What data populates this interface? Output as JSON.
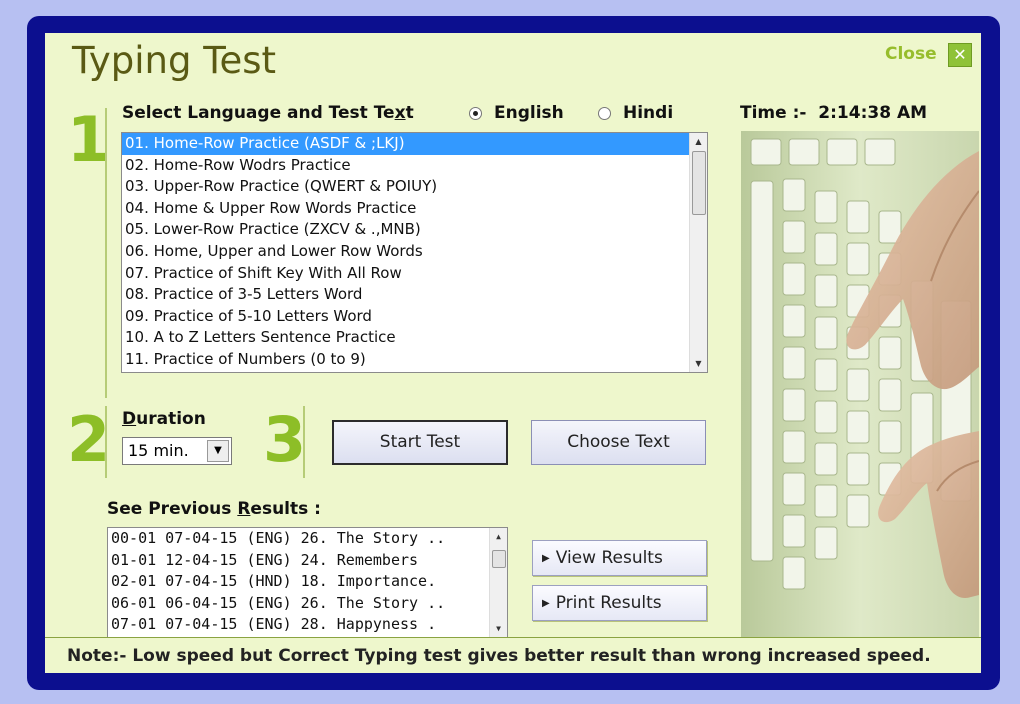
{
  "window": {
    "title": "Typing Test",
    "close_label": "Close",
    "close_icon": "x-icon"
  },
  "step_numbers": [
    "1",
    "2",
    "3"
  ],
  "language_section": {
    "label_pre": "Select Language and Test Te",
    "label_ul": "x",
    "label_post": "t",
    "languages": [
      "English",
      "Hindi"
    ],
    "selected_language": "English"
  },
  "time": {
    "label": "Time :-",
    "value": "2:14:38 AM"
  },
  "test_list": {
    "items": [
      "01. Home-Row Practice (ASDF & ;LKJ)",
      "02. Home-Row Wodrs Practice",
      "03. Upper-Row Practice (QWERT & POIUY)",
      "04. Home & Upper Row Words Practice",
      "05. Lower-Row Practice (ZXCV & .,MNB)",
      "06. Home, Upper and Lower Row Words",
      "07. Practice of Shift Key With All Row",
      "08. Practice of 3-5 Letters Word",
      "09. Practice of 5-10 Letters Word",
      "10. A to Z Letters Sentence Practice",
      "11. Practice of Numbers (0 to 9)"
    ],
    "selected_index": 0
  },
  "duration": {
    "label_ul": "D",
    "label_rest": "uration",
    "value": "15 min."
  },
  "buttons": {
    "start_test": "Start Test",
    "choose_text": "Choose Text",
    "view_results": "View Results",
    "print_results": "Print Results"
  },
  "results": {
    "label_pre": "See Previous ",
    "label_ul": "R",
    "label_post": "esults :",
    "rows": [
      "00-01  07-04-15  (ENG)  26. The Story ..",
      "01-01  12-04-15  (ENG)  24. Remembers",
      "02-01  07-04-15  (HND)  18. Importance.",
      "06-01  06-04-15  (ENG)  26. The Story ..",
      "07-01  07-04-15  (ENG)  28. Happyness ."
    ]
  },
  "note": "Note:- Low speed but Correct Typing test gives better result than wrong increased speed."
}
